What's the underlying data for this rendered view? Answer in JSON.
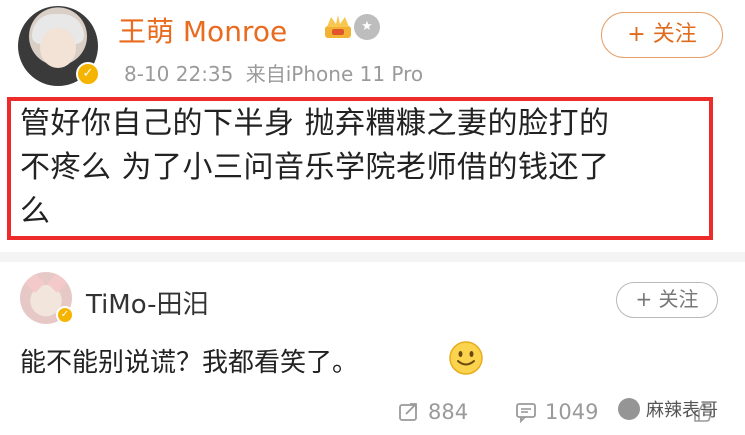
{
  "post": {
    "author_name": "王萌 Monroe",
    "verified_mark": "✓",
    "time": "8-10 22:35",
    "source": "来自iPhone 11 Pro",
    "follow_label": "+ 关注",
    "content_lines": [
      "管好你自己的下半身 抛弃糟糠之妻的脸打的",
      "不疼么 为了小三问音乐学院老师借的钱还了",
      "么"
    ]
  },
  "reply": {
    "author_name": "TiMo-田汨",
    "verified_mark": "✓",
    "follow_label": "+ 关注",
    "text": "能不能别说谎？我都看笑了。"
  },
  "actions": {
    "repost_count": "884",
    "comment_count": "1049"
  },
  "watermark": {
    "text": "麻辣表哥"
  },
  "icons": {
    "crown": "crown-icon",
    "medal": "medal-icon",
    "smile": "smile-emoji-icon",
    "repost": "repost-icon",
    "comment": "comment-icon",
    "like": "like-icon"
  },
  "colors": {
    "username": "#e86b1f",
    "highlight_border": "#ee2b2b",
    "verified": "#f5b400",
    "meta": "#9a9a9a"
  }
}
